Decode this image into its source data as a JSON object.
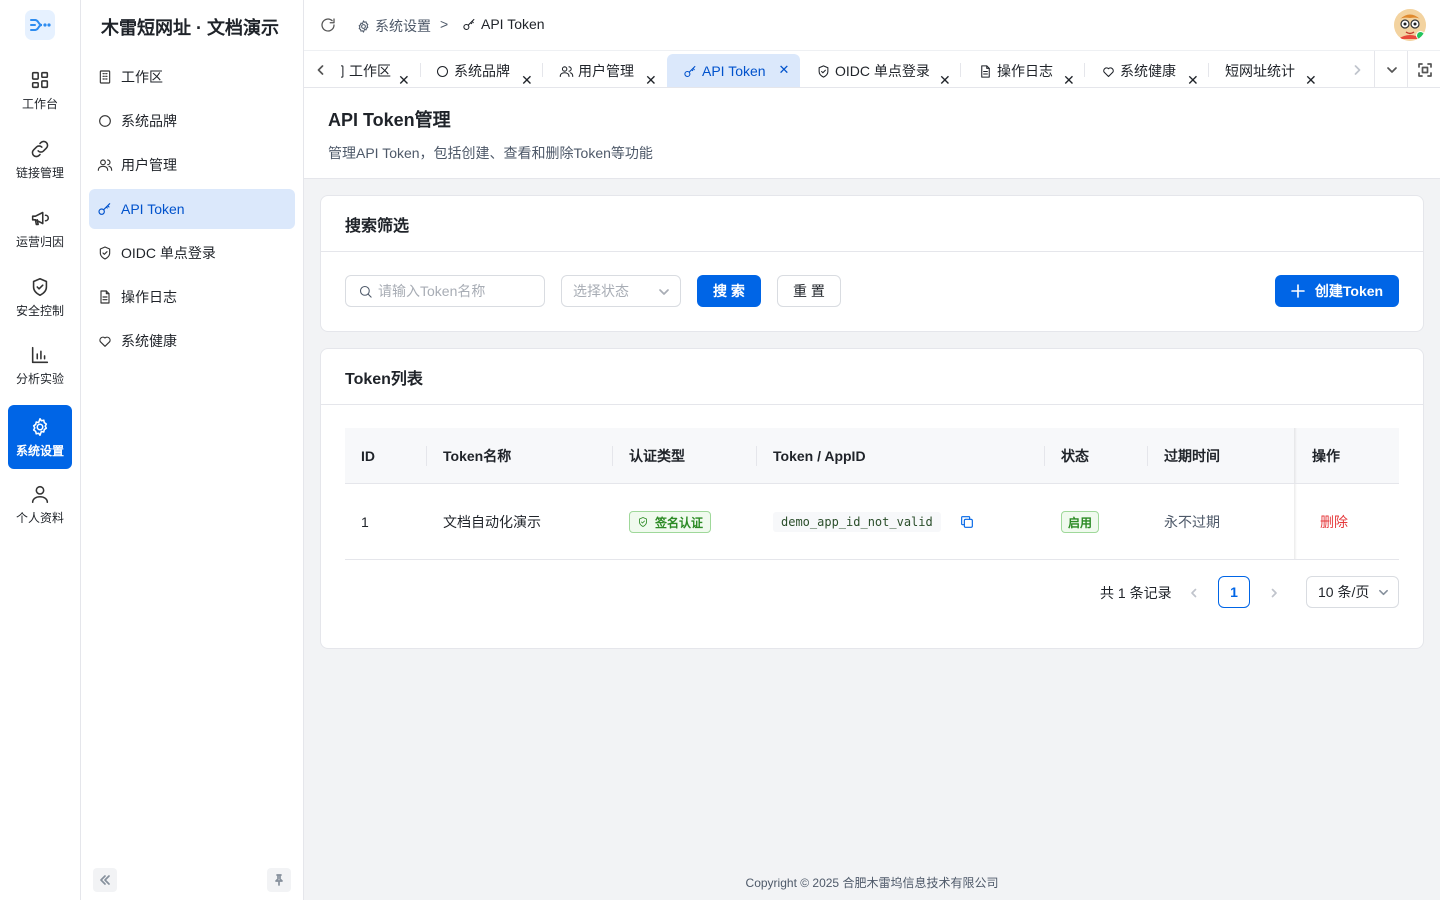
{
  "rail": {
    "items": [
      {
        "label": "工作台",
        "icon": "dashboard-icon"
      },
      {
        "label": "链接管理",
        "icon": "link-icon"
      },
      {
        "label": "运营归因",
        "icon": "megaphone-icon"
      },
      {
        "label": "安全控制",
        "icon": "shield-icon"
      },
      {
        "label": "分析实验",
        "icon": "bar-chart-icon"
      },
      {
        "label": "系统设置",
        "icon": "gear-icon",
        "active": true
      },
      {
        "label": "个人资料",
        "icon": "user-icon"
      }
    ]
  },
  "sidebar": {
    "title": "木雷短网址 · 文档演示",
    "items": [
      {
        "label": "工作区",
        "icon": "building-icon"
      },
      {
        "label": "系统品牌",
        "icon": "circle-icon"
      },
      {
        "label": "用户管理",
        "icon": "users-icon"
      },
      {
        "label": "API Token",
        "icon": "key-icon",
        "active": true
      },
      {
        "label": "OIDC 单点登录",
        "icon": "shield-check-icon"
      },
      {
        "label": "操作日志",
        "icon": "document-icon"
      },
      {
        "label": "系统健康",
        "icon": "heart-icon"
      }
    ]
  },
  "breadcrumb": {
    "parent": "系统设置",
    "separator": ">",
    "current": "API Token"
  },
  "tabs": [
    {
      "label": "工作区",
      "icon": "building-icon"
    },
    {
      "label": "系统品牌",
      "icon": "circle-icon"
    },
    {
      "label": "用户管理",
      "icon": "users-icon"
    },
    {
      "label": "API Token",
      "icon": "key-icon",
      "active": true
    },
    {
      "label": "OIDC 单点登录",
      "icon": "shield-check-icon"
    },
    {
      "label": "操作日志",
      "icon": "document-icon"
    },
    {
      "label": "系统健康",
      "icon": "heart-icon"
    },
    {
      "label": "短网址统计",
      "icon": ""
    }
  ],
  "page": {
    "title": "API Token管理",
    "description": "管理API Token，包括创建、查看和删除Token等功能"
  },
  "filter": {
    "card_title": "搜索筛选",
    "search_placeholder": "请输入Token名称",
    "status_placeholder": "选择状态",
    "search_button": "搜 索",
    "reset_button": "重 置",
    "create_button": "创建Token"
  },
  "table": {
    "card_title": "Token列表",
    "columns": [
      "ID",
      "Token名称",
      "认证类型",
      "Token / AppID",
      "状态",
      "过期时间",
      "操作"
    ],
    "rows": [
      {
        "id": "1",
        "name": "文档自动化演示",
        "auth_type": "签名认证",
        "token": "demo_app_id_not_valid",
        "status": "启用",
        "expires": "永不过期",
        "action": "删除"
      }
    ]
  },
  "pagination": {
    "total_text": "共 1 条记录",
    "current_page": "1",
    "page_size": "10 条/页"
  },
  "footer": "Copyright © 2025 合肥木雷坞信息技术有限公司",
  "colors": {
    "primary": "#0065e6",
    "active_bg": "#dbe8fb",
    "success": "#2b8a24",
    "danger": "#e5383b"
  }
}
